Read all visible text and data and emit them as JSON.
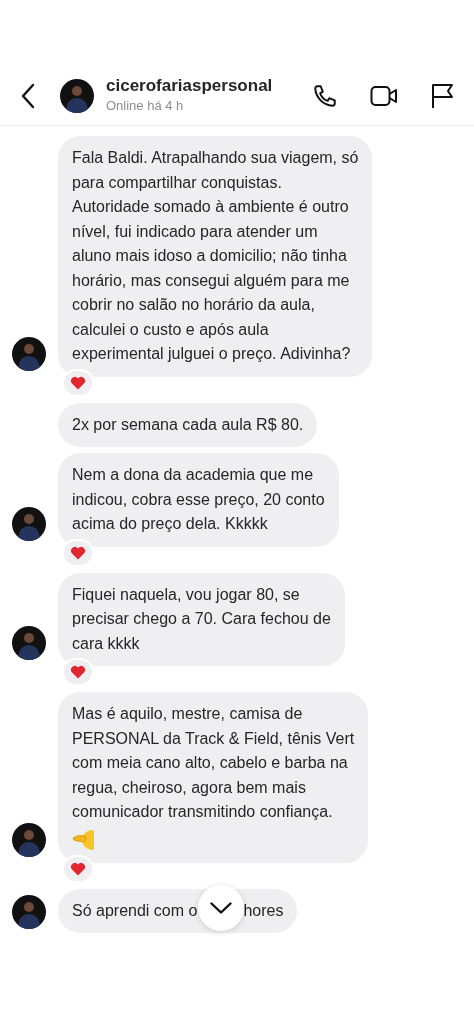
{
  "header": {
    "username": "cicerofariaspersonal",
    "status": "Online há 4 h"
  },
  "messages": [
    {
      "lines": [
        "Fala Baldi. Atrapalhando sua viagem, só",
        "para compartilhar conquistas.",
        "Autoridade somado à ambiente é outro",
        "nível, fui indicado para atender um",
        "aluno mais idoso a domicilio; não tinha",
        "horário, mas consegui alguém para me",
        "cobrir no salão no horário da aula,",
        "calculei o custo e após aula",
        "experimental julguei o preço. Adivinha?"
      ],
      "emoji": false,
      "reacted": true,
      "avatar": true
    },
    {
      "lines": [
        "2x por semana cada aula R$ 80."
      ],
      "emoji": false,
      "reacted": false,
      "avatar": false
    },
    {
      "lines": [
        "Nem a dona da academia que me",
        "indicou, cobra esse preço, 20 conto",
        "acima do preço dela. Kkkkk"
      ],
      "emoji": false,
      "reacted": true,
      "avatar": true
    },
    {
      "lines": [
        "Fiquei naquela, vou jogar 80, se",
        "precisar chego a 70. Cara fechou de",
        "cara kkkk"
      ],
      "emoji": false,
      "reacted": true,
      "avatar": true
    },
    {
      "lines": [
        "Mas é aquilo, mestre, camisa de",
        "PERSONAL da Track & Field, tênis Vert",
        "com meia cano alto, cabelo e barba na",
        "regua, cheiroso, agora bem mais",
        "comunicador transmitindo confiança."
      ],
      "emoji": true,
      "reacted": true,
      "avatar": true
    },
    {
      "lines": [
        "Só aprendi com o"
      ],
      "tail": "hores",
      "emoji": false,
      "reacted": false,
      "avatar": true
    }
  ]
}
